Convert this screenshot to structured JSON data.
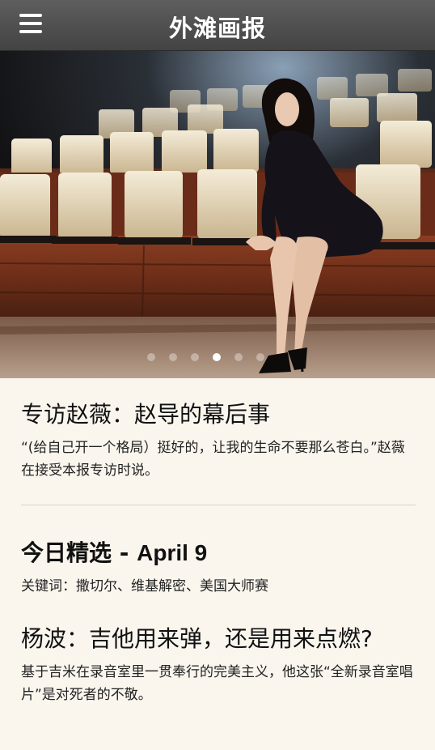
{
  "header": {
    "title": "外滩画报",
    "menu_icon": "hamburger-menu-icon"
  },
  "carousel": {
    "slide_count": 6,
    "active_index": 3,
    "image_subject": "cover photo"
  },
  "articles": [
    {
      "headline": "专访赵薇：赵导的幕后事",
      "summary": "“(给自己开一个格局）挺好的，让我的生命不要那么苍白。”赵薇在接受本报专访时说。"
    }
  ],
  "daily": {
    "label": "今日精选 - ",
    "date": "April 9",
    "keywords": "关键词：撒切尔、维基解密、美国大师赛",
    "article": {
      "headline": "杨波：吉他用来弹，还是用来点燃?",
      "summary": "基于吉米在录音室里一贯奉行的完美主义，他这张“全新录音室唱片”是对死者的不敬。"
    }
  }
}
